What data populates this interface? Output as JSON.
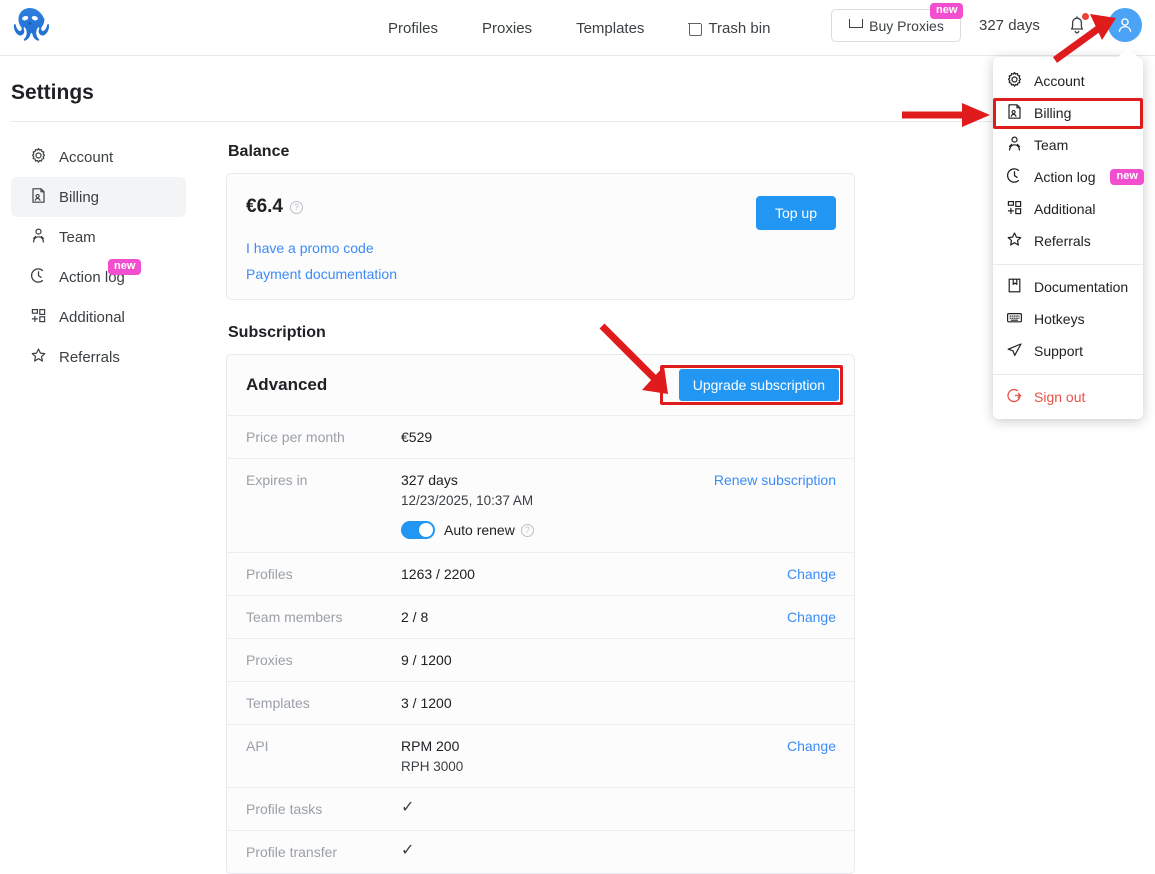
{
  "header": {
    "logo_alt": "Octo Browser logo",
    "nav": [
      {
        "label": "Profiles",
        "icon": ""
      },
      {
        "label": "Proxies",
        "icon": ""
      },
      {
        "label": "Templates",
        "icon": ""
      },
      {
        "label": "Trash bin",
        "icon": "trash-icon"
      }
    ],
    "buy_proxies_label": "Buy Proxies",
    "buy_proxies_badge": "new",
    "days_label": "327 days",
    "notification_dot": true
  },
  "dropdown": {
    "items": [
      {
        "label": "Account",
        "icon": "gear-icon"
      },
      {
        "label": "Billing",
        "icon": "billing-icon",
        "highlighted": true
      },
      {
        "label": "Team",
        "icon": "team-icon"
      },
      {
        "label": "Action log",
        "icon": "clock-icon",
        "badge": "new"
      },
      {
        "label": "Additional",
        "icon": "grid-icon"
      },
      {
        "label": "Referrals",
        "icon": "star-icon"
      }
    ],
    "items2": [
      {
        "label": "Documentation",
        "icon": "book-icon"
      },
      {
        "label": "Hotkeys",
        "icon": "keyboard-icon"
      },
      {
        "label": "Support",
        "icon": "send-icon"
      }
    ],
    "sign_out": {
      "label": "Sign out",
      "icon": "sign-out-icon"
    }
  },
  "page": {
    "title": "Settings"
  },
  "sidebar": {
    "items": [
      {
        "label": "Account",
        "icon": "gear-icon"
      },
      {
        "label": "Billing",
        "icon": "billing-icon",
        "active": true
      },
      {
        "label": "Team",
        "icon": "team-icon"
      },
      {
        "label": "Action log",
        "icon": "clock-icon",
        "badge": "new"
      },
      {
        "label": "Additional",
        "icon": "grid-icon"
      },
      {
        "label": "Referrals",
        "icon": "star-icon"
      }
    ]
  },
  "balance": {
    "section_title": "Balance",
    "amount": "€6.4",
    "help_glyph": "?",
    "promo_link": "I have a promo code",
    "payment_link": "Payment documentation",
    "topup_label": "Top up"
  },
  "subscription": {
    "section_title": "Subscription",
    "plan_name": "Advanced",
    "upgrade_label": "Upgrade subscription",
    "rows": [
      {
        "label": "Price per month",
        "value": "€529"
      },
      {
        "label": "Expires in",
        "value": "327 days",
        "sub": "12/23/2025, 10:37 AM",
        "action": "Renew subscription",
        "toggle_label": "Auto renew",
        "toggle_on": true
      },
      {
        "label": "Profiles",
        "value": "1263 / 2200",
        "action": "Change"
      },
      {
        "label": "Team members",
        "value": "2 / 8",
        "action": "Change"
      },
      {
        "label": "Proxies",
        "value": "9 / 1200"
      },
      {
        "label": "Templates",
        "value": "3 / 1200"
      },
      {
        "label": "API",
        "value": "RPM 200",
        "sub": "RPH 3000",
        "action": "Change"
      },
      {
        "label": "Profile tasks",
        "value": "✓"
      },
      {
        "label": "Profile transfer",
        "value": "✓"
      }
    ]
  },
  "annotations": {
    "accent_red": "#e01b1b",
    "arrow_to_billing": "points right to Billing menu item",
    "arrow_to_upgrade": "points down-right to Upgrade subscription button",
    "arrow_to_avatar": "points up-right to account avatar"
  },
  "colors": {
    "primary_blue": "#2196f3",
    "link_blue": "#3b8cf7",
    "badge_pink": "#f24fd0",
    "avatar_blue": "#4aa3f5",
    "sign_out_red": "#ea5146"
  }
}
